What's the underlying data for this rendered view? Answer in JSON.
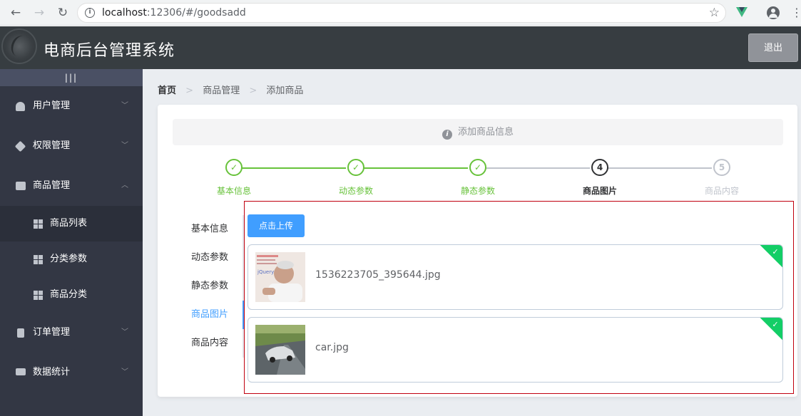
{
  "browser": {
    "url_host": "localhost",
    "url_rest": ":12306/#/goodsadd"
  },
  "header": {
    "title": "电商后台管理系统",
    "logout_label": "退出"
  },
  "sidebar": {
    "toggle_label": "|||",
    "items": [
      {
        "label": "用户管理",
        "icon": "user-icon",
        "expanded": false
      },
      {
        "label": "权限管理",
        "icon": "box-icon",
        "expanded": false
      },
      {
        "label": "商品管理",
        "icon": "bag-icon",
        "expanded": true
      },
      {
        "label": "订单管理",
        "icon": "document-icon",
        "expanded": false
      },
      {
        "label": "数据统计",
        "icon": "chart-icon",
        "expanded": false
      }
    ],
    "sub_items": [
      {
        "label": "商品列表",
        "icon": "grid-icon",
        "active": true
      },
      {
        "label": "分类参数",
        "icon": "grid-icon",
        "active": false
      },
      {
        "label": "商品分类",
        "icon": "grid-icon",
        "active": false
      }
    ]
  },
  "breadcrumb": [
    "首页",
    "商品管理",
    "添加商品"
  ],
  "alert": {
    "text": "添加商品信息",
    "icon": "info-icon"
  },
  "steps": [
    {
      "label": "基本信息",
      "status": "done",
      "marker": "✓"
    },
    {
      "label": "动态参数",
      "status": "done",
      "marker": "✓"
    },
    {
      "label": "静态参数",
      "status": "done",
      "marker": "✓"
    },
    {
      "label": "商品图片",
      "status": "process",
      "marker": "4"
    },
    {
      "label": "商品内容",
      "status": "wait",
      "marker": "5"
    }
  ],
  "tabs": [
    {
      "label": "基本信息",
      "active": false
    },
    {
      "label": "动态参数",
      "active": false
    },
    {
      "label": "静态参数",
      "active": false
    },
    {
      "label": "商品图片",
      "active": true
    },
    {
      "label": "商品内容",
      "active": false
    }
  ],
  "upload": {
    "button_label": "点击上传",
    "files": [
      {
        "name": "1536223705_395644.jpg",
        "status": "success"
      },
      {
        "name": "car.jpg",
        "status": "success"
      }
    ]
  },
  "colors": {
    "header_bg": "#373d41",
    "sidebar_bg": "#333744",
    "primary": "#409eff",
    "success": "#67c23a",
    "upload_success": "#13ce66",
    "highlight_border": "#c0000f"
  }
}
